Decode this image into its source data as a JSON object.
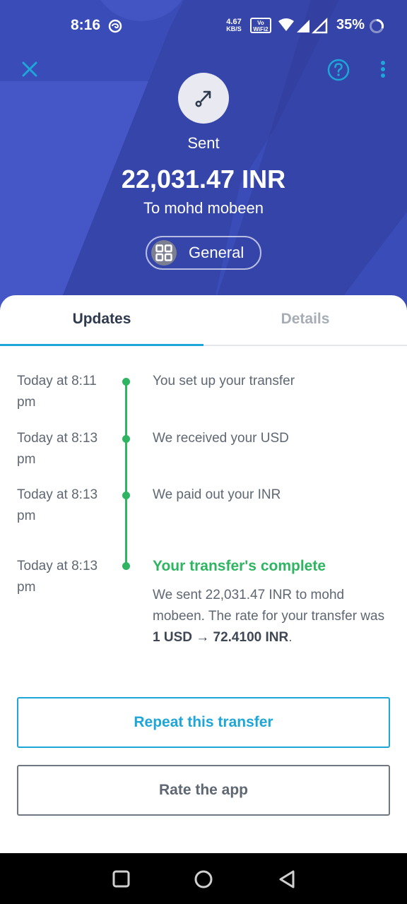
{
  "status_bar": {
    "time": "8:16",
    "net_speed_value": "4.67",
    "net_speed_unit": "KB/S",
    "wifi_badge_line1": "Vo",
    "wifi_badge_line2": "WiFi2",
    "battery": "35%"
  },
  "header": {
    "status_label": "Sent",
    "amount": "22,031.47 INR",
    "recipient": "To mohd mobeen",
    "category": "General"
  },
  "tabs": [
    {
      "label": "Updates",
      "active": true
    },
    {
      "label": "Details",
      "active": false
    }
  ],
  "timeline": [
    {
      "time": "Today at 8:11 pm",
      "text": "You set up your transfer"
    },
    {
      "time": "Today at 8:13 pm",
      "text": "We received your USD"
    },
    {
      "time": "Today at 8:13 pm",
      "text": "We paid out your INR"
    },
    {
      "time": "Today at 8:13 pm",
      "title": "Your transfer's complete",
      "text_before": "We sent 22,031.47 INR to mohd mobeen. The rate for your transfer was ",
      "rate": "1 USD → 72.4100 INR",
      "text_after": "."
    }
  ],
  "buttons": {
    "repeat": "Repeat this transfer",
    "rate": "Rate the app"
  },
  "colors": {
    "header_bg": "#3a4cb8",
    "accent": "#1ea6d8",
    "success": "#2fb562"
  }
}
